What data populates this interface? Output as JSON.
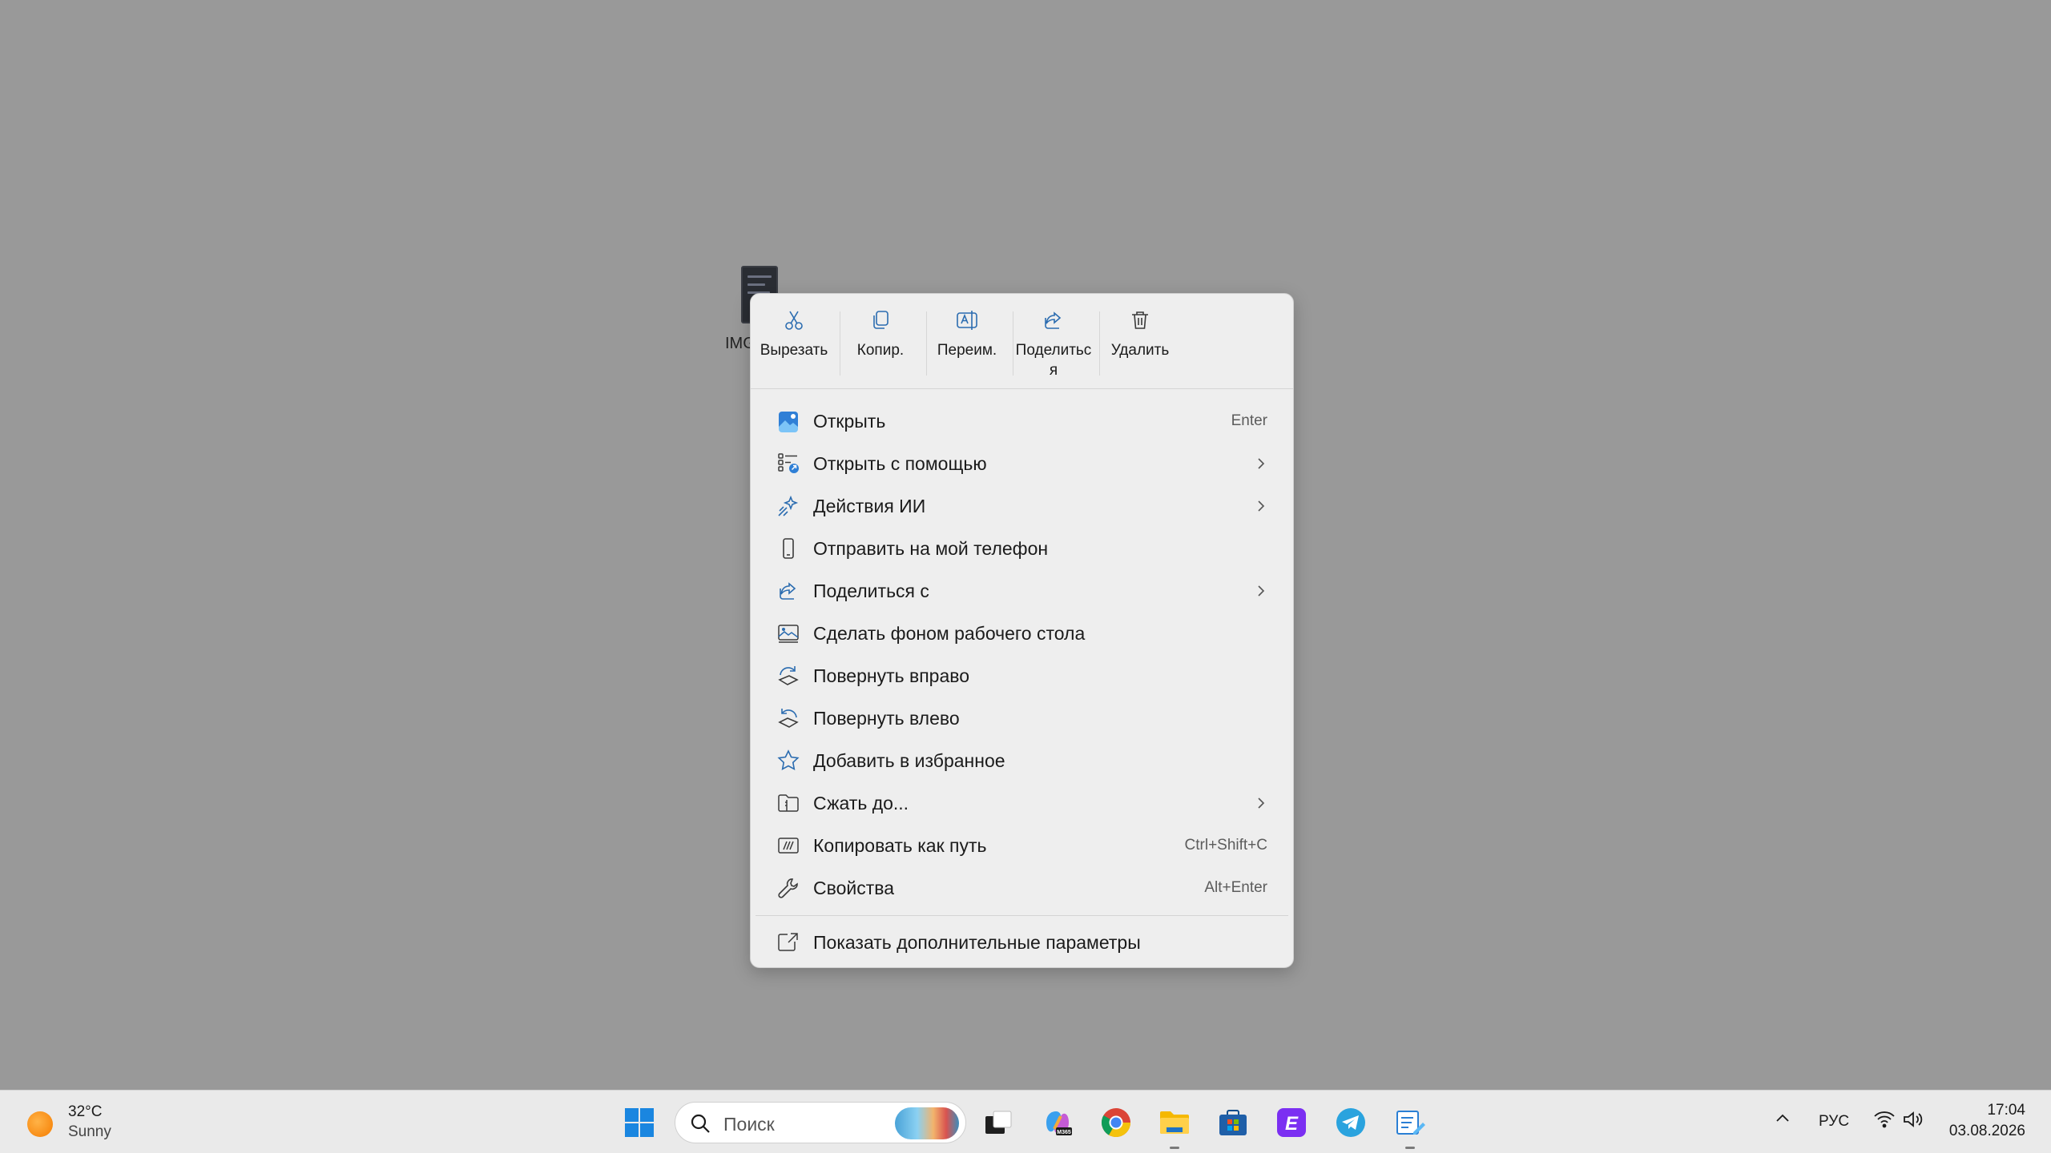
{
  "desktop": {
    "icon_label": "IMG"
  },
  "context_menu": {
    "quick_actions": [
      {
        "label": "Вырезать",
        "icon": "scissors-icon"
      },
      {
        "label": "Копир.",
        "icon": "copy-icon"
      },
      {
        "label": "Переим.",
        "icon": "rename-icon"
      },
      {
        "label": "Поделиться",
        "icon": "share-icon"
      },
      {
        "label": "Удалить",
        "icon": "trash-icon"
      }
    ],
    "items": [
      {
        "label": "Открыть",
        "shortcut": "Enter",
        "icon": "photos-app-icon"
      },
      {
        "label": "Открыть с помощью",
        "icon": "open-with-icon",
        "submenu": true
      },
      {
        "label": "Действия ИИ",
        "icon": "ai-sparkle-icon",
        "submenu": true
      },
      {
        "label": "Отправить на мой телефон",
        "icon": "phone-icon"
      },
      {
        "label": "Поделиться с",
        "icon": "share-icon",
        "submenu": true
      },
      {
        "label": "Сделать фоном рабочего стола",
        "icon": "wallpaper-icon"
      },
      {
        "label": "Повернуть вправо",
        "icon": "rotate-right-icon"
      },
      {
        "label": "Повернуть влево",
        "icon": "rotate-left-icon"
      },
      {
        "label": "Добавить в избранное",
        "icon": "star-icon"
      },
      {
        "label": "Сжать до...",
        "icon": "zip-folder-icon",
        "submenu": true
      },
      {
        "label": "Копировать как путь",
        "shortcut": "Ctrl+Shift+C",
        "icon": "copy-path-icon"
      },
      {
        "label": "Свойства",
        "shortcut": "Alt+Enter",
        "icon": "wrench-icon"
      }
    ],
    "more_options": {
      "label": "Показать дополнительные параметры",
      "icon": "more-options-icon"
    }
  },
  "taskbar": {
    "weather": {
      "temp": "32°C",
      "condition": "Sunny"
    },
    "search_placeholder": "Поиск",
    "apps": [
      "windows-start-icon",
      "task-view-icon",
      "m365-copilot-icon",
      "chrome-icon",
      "file-explorer-icon",
      "ms-store-icon",
      "elevenlabs-app-icon",
      "telegram-icon",
      "notepad-pen-icon"
    ],
    "language": "РУС",
    "time": "17:04",
    "date": "03.08.2026"
  },
  "colors": {
    "desktop_bg": "#999999",
    "menu_bg": "#eeeeee",
    "accent": "#1a73c8",
    "taskbar_bg": "#eaeaea"
  }
}
